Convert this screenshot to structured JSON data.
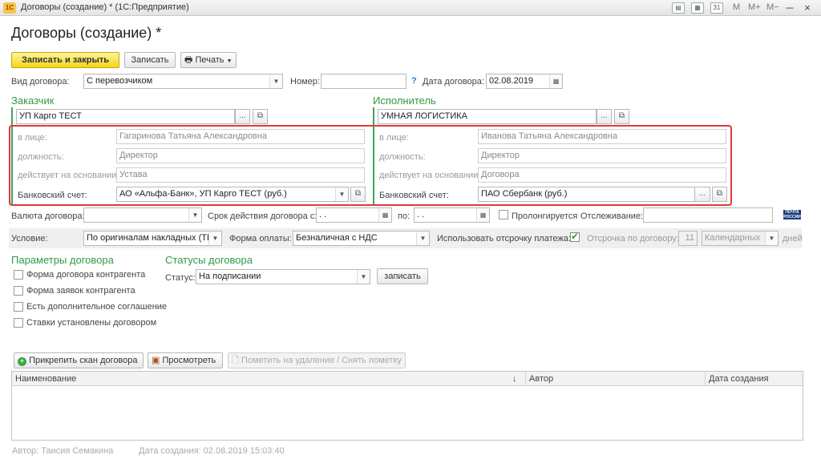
{
  "window": {
    "app_logo": "1С",
    "title": "Договоры (создание) * (1С:Предприятие)",
    "toolbar_m": "M",
    "toolbar_mplus": "M+",
    "toolbar_mminus": "M−",
    "minimize": "─",
    "close": "×"
  },
  "page": {
    "title": "Договоры (создание) *"
  },
  "toolbar": {
    "save_close": "Записать и закрыть",
    "save": "Записать",
    "print": "Печать"
  },
  "header": {
    "contract_type_label": "Вид договора:",
    "contract_type_value": "С перевозчиком",
    "number_label": "Номер:",
    "number_value": "",
    "help": "?",
    "date_label": "Дата договора:",
    "date_value": "02.08.2019"
  },
  "customer": {
    "title": "Заказчик",
    "name": "УП Карго ТЕСТ",
    "person_label": "в лице:",
    "person_value": "Гагаринова  Татьяна Александровна",
    "position_label": "должность:",
    "position_value": "Директор",
    "basis_label": "действует на основании:",
    "basis_value": "Устава",
    "bank_label": "Банковский счет:",
    "bank_value": "АО «Альфа-Банк», УП Карго ТЕСТ (руб.)"
  },
  "contractor": {
    "title": "Исполнитель",
    "name": "УМНАЯ ЛОГИСТИКА",
    "person_label": "в лице:",
    "person_value": "Иванова Татьяна Александровна",
    "position_label": "должность:",
    "position_value": "Директор",
    "basis_label": "действует на основании:",
    "basis_value": "Договора",
    "bank_label": "Банковский счет:",
    "bank_value": "ПАО Сбербанк    (руб.)"
  },
  "row_currency": {
    "currency_label": "Валюта договора:",
    "currency_value": "",
    "term_label": "Срок действия договора с:",
    "term_from": " .  .",
    "term_to_label": "по:",
    "term_to": " .  .",
    "prolong_label": "Пролонгируется",
    "tracking_label": "Отслеживание:",
    "tracking_value": "",
    "pochta_line1": "ПОЧТА",
    "pochta_line2": "РОССИИ"
  },
  "row_conditions": {
    "condition_label": "Условие:",
    "condition_value": "По оригиналам накладных (ТН",
    "payment_label": "Форма оплаты:",
    "payment_value": "Безналичная с НДС",
    "deferral_label": "Использовать отсрочку платежа:",
    "deferral_days_label": "Отсрочка по договору:",
    "deferral_days": "11",
    "deferral_kind": "Календарных",
    "days_label": "дней"
  },
  "params": {
    "title": "Параметры договора",
    "items": [
      "Форма договора контрагента",
      "Форма заявок контрагента",
      "Есть дополнительное соглашение",
      "Ставки установлены договором"
    ]
  },
  "statuses": {
    "title": "Статусы договора",
    "status_label": "Статус:",
    "status_value": "На подписании",
    "save_button": "записать"
  },
  "attachments": {
    "attach_button": "Прикрепить скан договора",
    "view_button": "Просмотреть",
    "delete_button": "Пометить на удаление / Снять пометку",
    "columns": [
      "Наименование",
      "Автор",
      "Дата создания"
    ],
    "sort_indicator": "↓"
  },
  "footer": {
    "author": "Автор: Таисия Семакина",
    "created": "Дата создания: 02.08.2019 15:03:40"
  }
}
